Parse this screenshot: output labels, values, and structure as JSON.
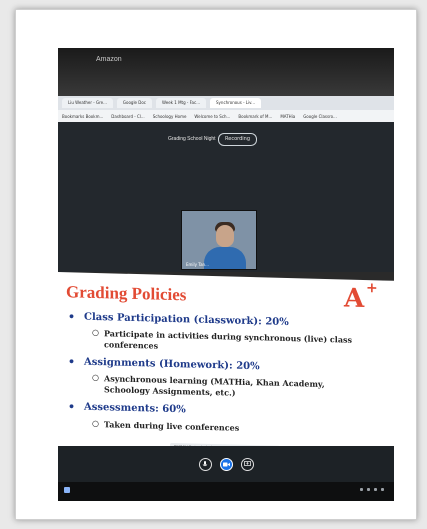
{
  "photo": {
    "laptop_brand": "Amazon",
    "browser_tabs": [
      "Liu Weather - Gre...",
      "Google Doc",
      "Week 1 Mtg - Fac...",
      "Synchronous - Liv..."
    ],
    "bookmarks": [
      "Bookmarks Bookm...",
      "Dashboard - Cl...",
      "Schoology Home",
      "Welcome to Sch...",
      "Bookmark of M...",
      "MATHia",
      "Google Classro..."
    ],
    "meeting": {
      "title": "Grading School Night",
      "recording_label": "Recording",
      "participant_name": "Emily Tan..."
    },
    "slide": {
      "title": "Grading Policies",
      "grade_mark": "A",
      "grade_plus": "+",
      "items": [
        {
          "text": "Class Participation (classwork): 20%",
          "sub": [
            "Participate in activities during synchronous (live) class conferences"
          ]
        },
        {
          "text": "Assignments (Homework): 20%",
          "sub": [
            "Asynchronous learning (MATHia, Khan Academy, Schoology Assignments, etc.)"
          ]
        },
        {
          "text": "Assessments: 60%",
          "sub": [
            "Taken during live conferences"
          ]
        }
      ],
      "share_bar_text": "meet.google.com is sharing your screen"
    },
    "controls": [
      "mic-icon",
      "camera-icon",
      "present-icon"
    ]
  },
  "colors": {
    "title_red": "#e24b34",
    "bullet_blue": "#1e3a8a",
    "meet_blue": "#1b73e8"
  }
}
